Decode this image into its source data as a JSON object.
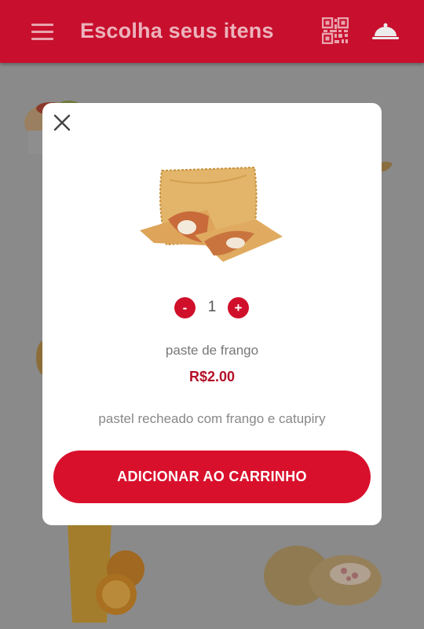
{
  "appbar": {
    "title": "Escolha seus itens",
    "menu_icon": "hamburger-menu-icon",
    "qr_icon": "qr-code-icon",
    "cart_icon": "food-cloche-icon",
    "color": "#c8102e"
  },
  "modal": {
    "close_icon": "close-icon",
    "product_image": "pastel-image",
    "quantity": {
      "minus_label": "-",
      "value": "1",
      "plus_label": "+"
    },
    "product_name": "paste de frango",
    "price": "R$2.00",
    "description": "pastel recheado com frango e catupiry",
    "add_button_label": "ADICIONAR AO CARRINHO",
    "accent_color": "#d9102c"
  }
}
